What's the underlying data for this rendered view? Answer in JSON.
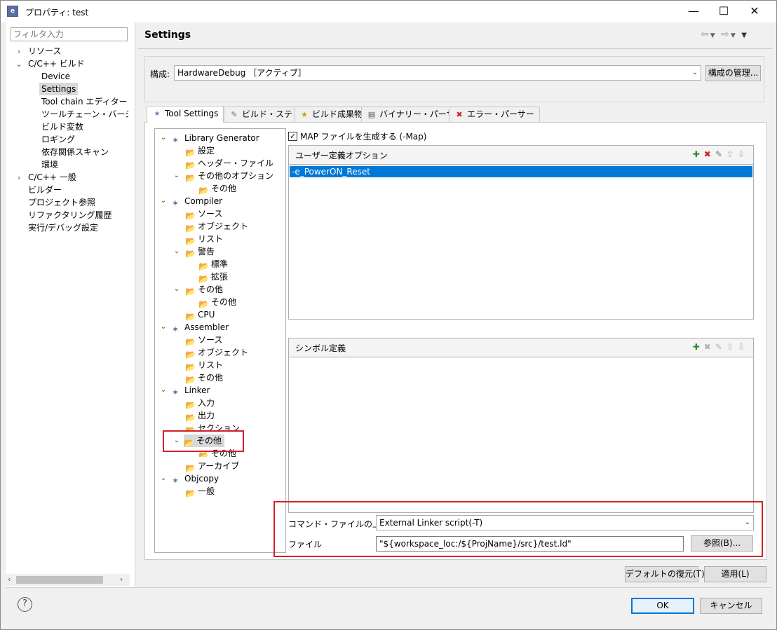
{
  "window": {
    "title": "プロパティ: test",
    "icon": "e-icon"
  },
  "filter": {
    "placeholder": "フィルタ入力"
  },
  "nav": [
    {
      "label": "リソース",
      "arrow": "›"
    },
    {
      "label": "C/C++ ビルド",
      "arrow": "⌄"
    },
    {
      "label": "Device"
    },
    {
      "label": "Settings"
    },
    {
      "label": "Tool chain エディター"
    },
    {
      "label": "ツールチェーン・バージョンの"
    },
    {
      "label": "ビルド変数"
    },
    {
      "label": "ロギング"
    },
    {
      "label": "依存関係スキャン"
    },
    {
      "label": "環境"
    },
    {
      "label": "C/C++ 一般",
      "arrow": "›"
    },
    {
      "label": "ビルダー"
    },
    {
      "label": "プロジェクト参照"
    },
    {
      "label": "リファクタリング履歴"
    },
    {
      "label": "実行/デバッグ設定"
    }
  ],
  "page": {
    "heading": "Settings"
  },
  "config": {
    "label": "構成:",
    "value": "HardwareDebug ［アクティブ］",
    "manage_button": "構成の管理..."
  },
  "tabs": [
    {
      "label": "Tool Settings",
      "icon": "tool-settings-icon"
    },
    {
      "label": "ビルド・ステップ",
      "icon": "build-steps-icon"
    },
    {
      "label": "ビルド成果物",
      "icon": "trophy-icon"
    },
    {
      "label": "バイナリー・パーサー",
      "icon": "binary-icon"
    },
    {
      "label": "エラー・パーサー",
      "icon": "error-icon"
    }
  ],
  "tree": [
    {
      "label": "Library Generator"
    },
    {
      "label": "設定"
    },
    {
      "label": "ヘッダー・ファイル"
    },
    {
      "label": "その他のオプション"
    },
    {
      "label": "その他"
    },
    {
      "label": "Compiler"
    },
    {
      "label": "ソース"
    },
    {
      "label": "オブジェクト"
    },
    {
      "label": "リスト"
    },
    {
      "label": "警告"
    },
    {
      "label": "標準"
    },
    {
      "label": "拡張"
    },
    {
      "label": "その他"
    },
    {
      "label": "その他"
    },
    {
      "label": "CPU"
    },
    {
      "label": "Assembler"
    },
    {
      "label": "ソース"
    },
    {
      "label": "オブジェクト"
    },
    {
      "label": "リスト"
    },
    {
      "label": "その他"
    },
    {
      "label": "Linker"
    },
    {
      "label": "入力"
    },
    {
      "label": "出力"
    },
    {
      "label": "セクション"
    },
    {
      "label": "その他"
    },
    {
      "label": "その他"
    },
    {
      "label": "アーカイブ"
    },
    {
      "label": "Objcopy"
    },
    {
      "label": "一般"
    }
  ],
  "map_checkbox": {
    "label": "MAP ファイルを生成する (-Map)",
    "checked": true
  },
  "user_options": {
    "title": "ユーザー定義オプション",
    "items": [
      "-e_PowerON_Reset"
    ]
  },
  "symbols": {
    "title": "シンボル定義"
  },
  "override": {
    "label": "コマンド・ファイルの上書き",
    "value": "External Linker script(-T)"
  },
  "file": {
    "label": "ファイル",
    "value": "\"${workspace_loc:/${ProjName}/src}/test.ld\"",
    "browse_button": "参照(B)..."
  },
  "buttons": {
    "restore": "デフォルトの復元(T)",
    "apply": "適用(L)",
    "ok": "OK",
    "cancel": "キャンセル"
  },
  "colors": {
    "selection": "#0078d7",
    "highlight_box": "#d0232b"
  }
}
